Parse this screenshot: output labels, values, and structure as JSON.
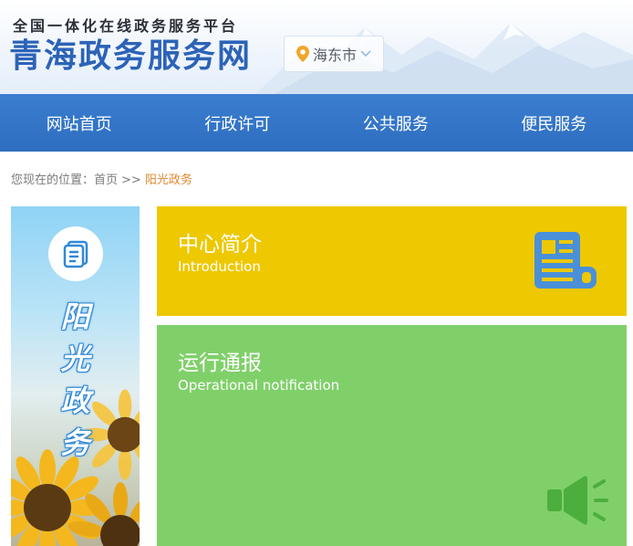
{
  "header": {
    "slogan": "全国一体化在线政务服务平台",
    "site_title": "青海政务服务网",
    "city": "海东市",
    "pin_icon": "location-pin-icon",
    "dropdown_icon": "chevron-down-icon"
  },
  "nav": {
    "items": [
      {
        "label": "网站首页"
      },
      {
        "label": "行政许可"
      },
      {
        "label": "公共服务"
      },
      {
        "label": "便民服务"
      }
    ]
  },
  "breadcrumb": {
    "prefix": "您现在的位置：",
    "home": "首页",
    "separator": ">>",
    "current": "阳光政务"
  },
  "banner": {
    "icon": "document-list-icon",
    "chars": [
      "阳",
      "光",
      "政",
      "务"
    ]
  },
  "cards": [
    {
      "title": "中心简介",
      "subtitle": "Introduction",
      "icon": "newspaper-icon"
    },
    {
      "title": "运行通报",
      "subtitle": "Operational notification",
      "icon": "speaker-icon"
    }
  ],
  "colors": {
    "brand_blue": "#2c63b8",
    "nav_blue": "#3a7dcf",
    "breadcrumb_current": "#e5872e",
    "card_yellow": "#eec800",
    "card_green": "#80d06a",
    "icon_blue": "#4a90d9",
    "icon_green": "#4cae3c"
  }
}
